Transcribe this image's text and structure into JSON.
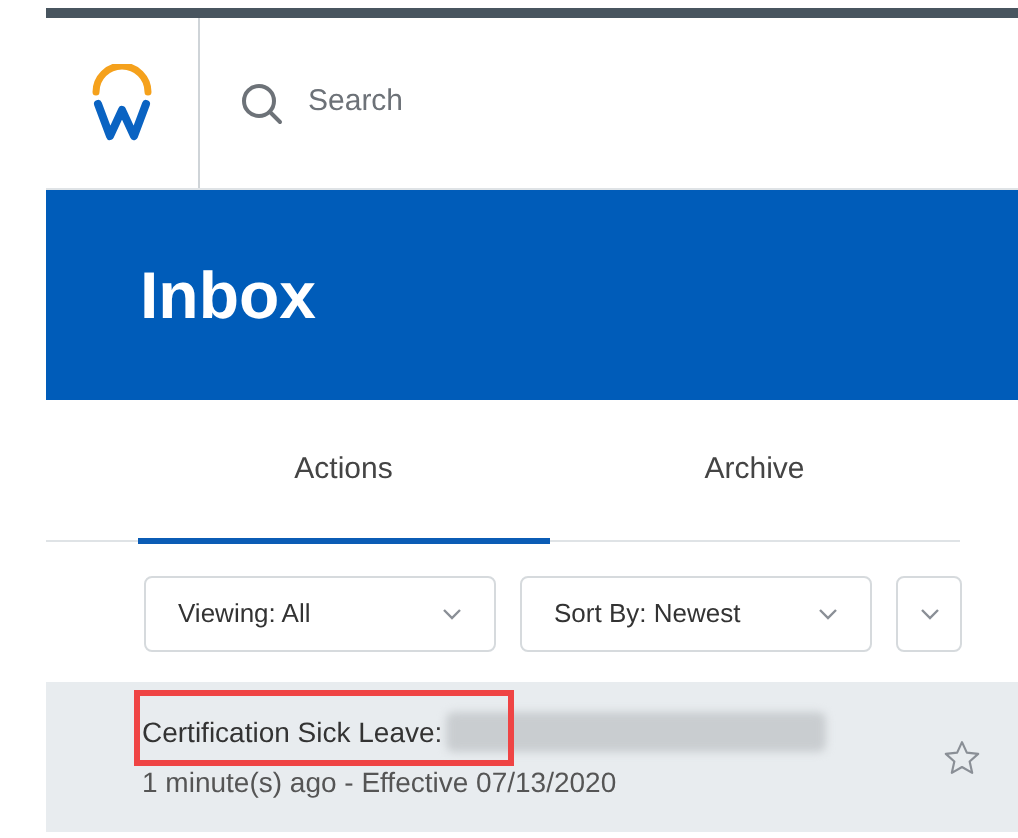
{
  "header": {
    "search": {
      "placeholder": "Search"
    }
  },
  "banner": {
    "title": "Inbox"
  },
  "tabs": [
    {
      "label": "Actions",
      "selected": true
    },
    {
      "label": "Archive",
      "selected": false
    }
  ],
  "filters": [
    {
      "label": "Viewing: All"
    },
    {
      "label": "Sort By: Newest"
    }
  ],
  "items": [
    {
      "title": "Certification Sick Leave:",
      "subtitle": "1 minute(s) ago - Effective 07/13/2020",
      "highlighted": true,
      "starred": false,
      "selected": true
    }
  ]
}
